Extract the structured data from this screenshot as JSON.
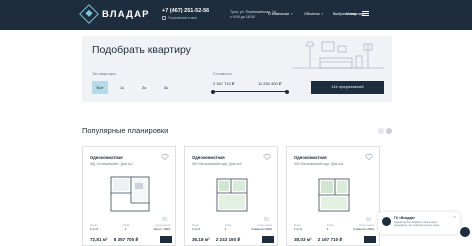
{
  "header": {
    "logo_text": "ВЛАДАР",
    "phone": "+7 (467) 251-52-56",
    "callback_label": "Перезвоните мне",
    "address_line1": "Тула, ул. Первомайская, 1А",
    "address_line2": "с 9:00 до 18:00",
    "nav": [
      "О компании",
      "Объекты",
      "Выбрать квартиру"
    ],
    "menu_label": "Меню"
  },
  "hero": {
    "title": "Подобрать квартиру",
    "rooms_label": "Тип квартиры",
    "rooms": [
      "Все",
      "1к",
      "2к",
      "3к"
    ],
    "cost_label": "Стоимость",
    "price_min": "2 167 710 ₽",
    "price_max": "11 252 400 ₽",
    "cta_label": "144 предложений"
  },
  "section": {
    "title": "Популярные планировки"
  },
  "cards": [
    {
      "type": "Однокомнатная",
      "address": "ЖД «Солнцевский». Дом №1",
      "col_headers": [
        "Этаж",
        "Этаж",
        "Срок сдачи"
      ],
      "col_values": [
        "1 из 6",
        "1",
        "Август 2023"
      ],
      "area": "72,81 м²",
      "price": "8 357 700 ₽"
    },
    {
      "type": "Однокомнатная",
      "address": "ЖК «Батышевский сад». Дом №3",
      "col_headers": [
        "Этаж",
        "Этаж",
        "Срок сдачи"
      ],
      "col_values": [
        "1 из 6",
        "1",
        "4 квартал 2024"
      ],
      "area": "36,18 м²",
      "price": "2 243 160 ₽"
    },
    {
      "type": "Однокомнатная",
      "address": "ЖК «Батышевский сад». Дом №4",
      "col_headers": [
        "Этаж",
        "Этаж",
        "Срок сдачи"
      ],
      "col_values": [
        "1 из 6",
        "1",
        "4 квартал 2024"
      ],
      "area": "38,03 м²",
      "price": "2 167 710 ₽"
    }
  ],
  "chat": {
    "name": "ГК «Владар»",
    "message": "Здравствуйте! Задайте свой вопрос менеджеру, мы ответим на него сразу"
  }
}
